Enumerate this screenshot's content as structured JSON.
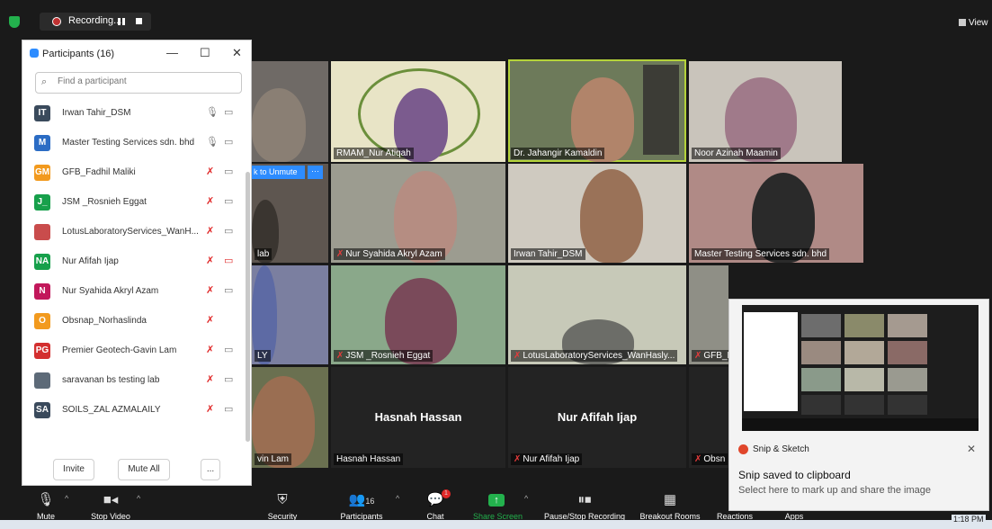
{
  "recording": {
    "label": "Recording...",
    "view_label": "View"
  },
  "participants_panel": {
    "title": "Participants (16)",
    "search_placeholder": "Find a participant",
    "minimize": "—",
    "maximize": "☐",
    "close": "✕",
    "participants": [
      {
        "initials": "IT",
        "name": "Irwan Tahir_DSM",
        "color": "#3a4a5c",
        "mic": "on",
        "video": "off"
      },
      {
        "initials": "M",
        "name": "Master Testing Services sdn. bhd",
        "color": "#2b6cc4",
        "mic": "on",
        "video": "off"
      },
      {
        "initials": "GM",
        "name": "GFB_Fadhil Maliki",
        "color": "#f29a1e",
        "mic": "muted",
        "video": "off"
      },
      {
        "initials": "J_",
        "name": "JSM _Rosnieh Eggat",
        "color": "#17a04b",
        "mic": "muted",
        "video": "off"
      },
      {
        "initials": "",
        "name": "LotusLaboratoryServices_WanH...",
        "color": "#c94c4c",
        "mic": "muted",
        "video": "off"
      },
      {
        "initials": "NA",
        "name": "Nur Afifah Ijap",
        "color": "#17a04b",
        "mic": "muted",
        "video": "muted"
      },
      {
        "initials": "N",
        "name": "Nur Syahida Akryl Azam",
        "color": "#c2185b",
        "mic": "muted",
        "video": "off"
      },
      {
        "initials": "O",
        "name": "Obsnap_Norhaslinda",
        "color": "#f29a1e",
        "mic": "muted",
        "video": "none"
      },
      {
        "initials": "PG",
        "name": "Premier Geotech-Gavin Lam",
        "color": "#d32f2f",
        "mic": "muted",
        "video": "off"
      },
      {
        "initials": "",
        "name": "saravanan bs testing lab",
        "color": "#5d6a78",
        "mic": "muted",
        "video": "off"
      },
      {
        "initials": "SA",
        "name": "SOILS_ZAL AZMALAILY",
        "color": "#3a4a5c",
        "mic": "muted",
        "video": "off"
      }
    ],
    "invite_label": "Invite",
    "mute_all_label": "Mute All",
    "more_label": "..."
  },
  "video_tiles": [
    {
      "label": "RMAM_Nur Atiqah",
      "muted": false
    },
    {
      "label": "Dr. Jahangir Kamaldin",
      "muted": false
    },
    {
      "label": "Noor Azinah Maamin",
      "muted": false
    },
    {
      "label": "lab",
      "muted": false
    },
    {
      "label": "Nur Syahida Akryl Azam",
      "muted": true
    },
    {
      "label": "Irwan Tahir_DSM",
      "muted": false
    },
    {
      "label": "Master Testing Services sdn. bhd",
      "muted": false
    },
    {
      "label": "LY",
      "muted": false
    },
    {
      "label": "JSM _Rosnieh Eggat",
      "muted": true
    },
    {
      "label": "LotusLaboratoryServices_WanHasly...",
      "muted": true
    },
    {
      "label": "GFB_F",
      "muted": true
    },
    {
      "label": "vin Lam",
      "muted": false
    },
    {
      "label": "Hasnah Hassan",
      "muted": false,
      "center": "Hasnah Hassan"
    },
    {
      "label": "Nur Afifah Ijap",
      "muted": true,
      "center": "Nur Afifah Ijap"
    },
    {
      "label": "Obsn",
      "muted": true
    }
  ],
  "unmute_overlay": {
    "label": "k to Unmute",
    "more": "···"
  },
  "toolbar": {
    "mute": "Mute",
    "stop_video": "Stop Video",
    "security": "Security",
    "participants": "Participants",
    "participants_count": "16",
    "chat": "Chat",
    "chat_badge": "1",
    "share_screen": "Share Screen",
    "pause_recording": "Pause/Stop Recording",
    "breakout_rooms": "Breakout Rooms",
    "reactions": "Reactions",
    "apps": "Apps"
  },
  "toast": {
    "app_name": "Snip & Sketch",
    "title": "Snip saved to clipboard",
    "body": "Select here to mark up and share the image",
    "close": "✕"
  },
  "taskbar": {
    "time": "1:18 PM"
  }
}
